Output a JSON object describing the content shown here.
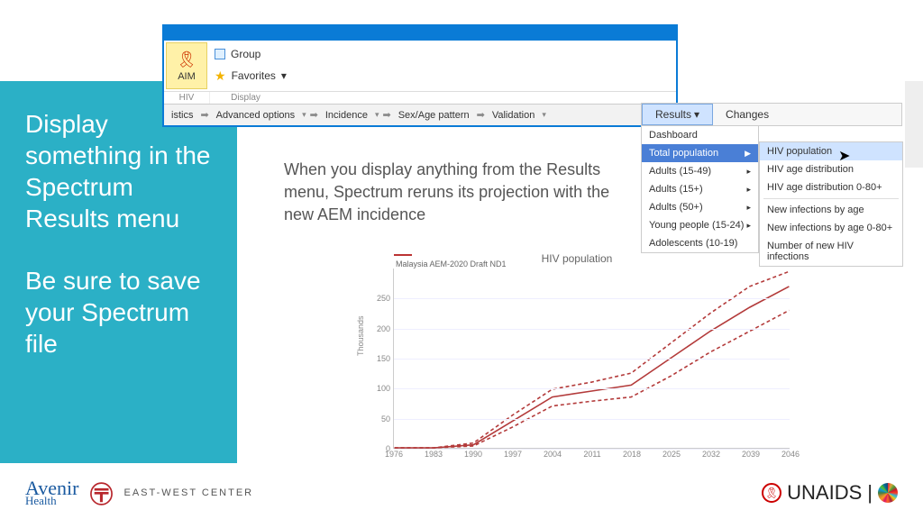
{
  "sidebar": {
    "text1": "Display something in the Spectrum Results menu",
    "text2": "Be sure to save your Spectrum file"
  },
  "ribbon": {
    "aim": "AIM",
    "hiv": "HIV",
    "group": "Group",
    "favorites": "Favorites",
    "displayGroup": "Display",
    "tabs": {
      "statistics": "istics",
      "advanced": "Advanced options",
      "incidence": "Incidence",
      "sexage": "Sex/Age pattern",
      "validation": "Validation"
    }
  },
  "menubar": {
    "results": "Results",
    "changes": "Changes"
  },
  "menu1": {
    "dashboard": "Dashboard",
    "totalpop": "Total population",
    "adults1549": "Adults (15-49)",
    "adults15": "Adults (15+)",
    "adults50": "Adults (50+)",
    "young": "Young people (15-24)",
    "adolescents": "Adolescents (10-19)"
  },
  "menu2": {
    "hivpop": "HIV population",
    "hivage": "HIV age distribution",
    "hivage80": "HIV age distribution 0-80+",
    "newage": "New infections by age",
    "newage80": "New infections by age 0-80+",
    "newnum": "Number of new HIV infections"
  },
  "body_text": "When you display anything from the Results menu, Spectrum reruns its projection with the new AEM incidence",
  "footer": {
    "avenir1": "Avenir",
    "avenir2": "Health",
    "ewc": "EAST-WEST CENTER",
    "unaids": "UNAIDS"
  },
  "chart_data": {
    "type": "line",
    "title": "HIV population",
    "series_label": "Malaysia AEM-2020 Draft ND1",
    "ylabel": "Thousands",
    "ylim": [
      0,
      300
    ],
    "yticks": [
      0,
      50,
      100,
      150,
      200,
      250
    ],
    "x": [
      1976,
      1983,
      1990,
      1997,
      2004,
      2011,
      2018,
      2025,
      2032,
      2039,
      2046
    ],
    "series": [
      {
        "name": "central",
        "dash": "solid",
        "color": "#b33a3a",
        "values": [
          0,
          0,
          5,
          45,
          85,
          95,
          105,
          150,
          195,
          235,
          270
        ]
      },
      {
        "name": "lower",
        "dash": "dashed",
        "color": "#b33a3a",
        "values": [
          0,
          0,
          3,
          35,
          70,
          78,
          85,
          120,
          160,
          195,
          230
        ]
      },
      {
        "name": "upper",
        "dash": "dashed",
        "color": "#b33a3a",
        "values": [
          0,
          0,
          8,
          55,
          98,
          110,
          125,
          175,
          225,
          270,
          295
        ]
      }
    ]
  }
}
